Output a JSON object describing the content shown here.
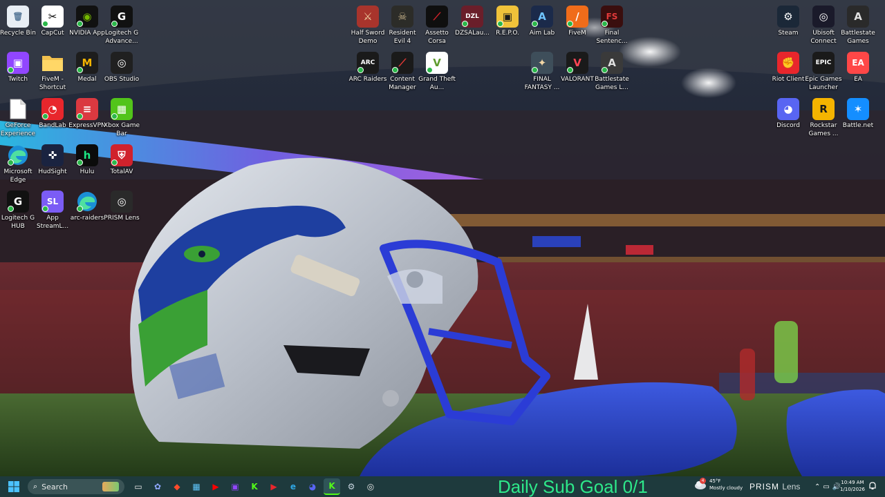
{
  "desktop": {
    "icons": [
      {
        "label": "Recycle Bin",
        "icon": "recycle-bin-icon",
        "bg": "#e8eef5",
        "fg": "#5a7a9a",
        "glyph": "🗑",
        "shortcut": false
      },
      {
        "label": "CapCut",
        "icon": "capcut-icon",
        "bg": "#ffffff",
        "fg": "#000000",
        "glyph": "✂",
        "shortcut": true
      },
      {
        "label": "NVIDIA App",
        "icon": "nvidia-icon",
        "bg": "#111111",
        "fg": "#76b900",
        "glyph": "◉",
        "shortcut": true
      },
      {
        "label": "Logitech G Advance...",
        "icon": "logitech-g-icon",
        "bg": "#111111",
        "fg": "#ffffff",
        "glyph": "G",
        "shortcut": true
      },
      {
        "label": "Twitch",
        "icon": "twitch-icon",
        "bg": "#9146ff",
        "fg": "#ffffff",
        "glyph": "▣",
        "shortcut": true
      },
      {
        "label": "FiveM - Shortcut",
        "icon": "folder-icon",
        "bg": "#f2c14e",
        "fg": "#c08a1a",
        "glyph": "",
        "shortcut": false
      },
      {
        "label": "Medal",
        "icon": "medal-icon",
        "bg": "#1d1d1d",
        "fg": "#f5b400",
        "glyph": "M",
        "shortcut": true
      },
      {
        "label": "OBS Studio",
        "icon": "obs-icon",
        "bg": "#202020",
        "fg": "#ffffff",
        "glyph": "◎",
        "shortcut": false
      },
      {
        "label": "GeForce Experience",
        "icon": "document-icon",
        "bg": "#ffffff",
        "fg": "#888888",
        "glyph": "",
        "shortcut": false
      },
      {
        "label": "BandLab",
        "icon": "bandlab-icon",
        "bg": "#e8262c",
        "fg": "#ffffff",
        "glyph": "◔",
        "shortcut": true
      },
      {
        "label": "ExpressVPN",
        "icon": "expressvpn-icon",
        "bg": "#da3940",
        "fg": "#ffffff",
        "glyph": "≡",
        "shortcut": true
      },
      {
        "label": "Xbox Game Bar",
        "icon": "xbox-game-bar-icon",
        "bg": "#52c41a",
        "fg": "#ffffff",
        "glyph": "▦",
        "shortcut": true
      },
      {
        "label": "Microsoft Edge",
        "icon": "edge-icon",
        "bg": "#1b8fd6",
        "fg": "#4fe0a0",
        "glyph": "e",
        "shortcut": true
      },
      {
        "label": "HudSight",
        "icon": "hudsight-icon",
        "bg": "#1a2340",
        "fg": "#ffffff",
        "glyph": "✜",
        "shortcut": false
      },
      {
        "label": "Hulu",
        "icon": "hulu-icon",
        "bg": "#0b0b0b",
        "fg": "#1ce783",
        "glyph": "h",
        "shortcut": true
      },
      {
        "label": "TotalAV",
        "icon": "totalav-icon",
        "bg": "#d0222c",
        "fg": "#ffffff",
        "glyph": "⛨",
        "shortcut": true
      },
      {
        "label": "Logitech G HUB",
        "icon": "logitech-g-hub-icon",
        "bg": "#111111",
        "fg": "#ffffff",
        "glyph": "G",
        "shortcut": true
      },
      {
        "label": "App StreamL...",
        "icon": "streamlabs-icon",
        "bg": "#7b5cf5",
        "fg": "#ffffff",
        "glyph": "SL",
        "shortcut": true
      },
      {
        "label": "arc-raiders",
        "icon": "edge-icon",
        "bg": "#1b8fd6",
        "fg": "#4fe0a0",
        "glyph": "e",
        "shortcut": true
      },
      {
        "label": "PRISM Lens",
        "icon": "prism-lens-icon",
        "bg": "#2a2a2a",
        "fg": "#ffffff",
        "glyph": "◎",
        "shortcut": false
      },
      {
        "label": "Half Sword Demo",
        "icon": "half-sword-icon",
        "bg": "#a8342c",
        "fg": "#f2d7a6",
        "glyph": "⚔",
        "shortcut": false
      },
      {
        "label": "Resident Evil 4",
        "icon": "resident-evil-4-icon",
        "bg": "#2c2c28",
        "fg": "#c7b38a",
        "glyph": "☠",
        "shortcut": false
      },
      {
        "label": "Assetto Corsa",
        "icon": "assetto-corsa-icon",
        "bg": "#0f0f0f",
        "fg": "#d3222a",
        "glyph": "⟋",
        "shortcut": false
      },
      {
        "label": "DZSALau...",
        "icon": "dzsa-launcher-icon",
        "bg": "#6a1e2a",
        "fg": "#ffffff",
        "glyph": "DZL",
        "shortcut": true
      },
      {
        "label": "R.E.P.O.",
        "icon": "repo-icon",
        "bg": "#f0c23a",
        "fg": "#1a1a1a",
        "glyph": "▣",
        "shortcut": true
      },
      {
        "label": "Aim Lab",
        "icon": "aim-lab-icon",
        "bg": "#1b2a4a",
        "fg": "#6ec3ff",
        "glyph": "A",
        "shortcut": true
      },
      {
        "label": "FiveM",
        "icon": "fivem-icon",
        "bg": "#f06c1a",
        "fg": "#ffffff",
        "glyph": "/",
        "shortcut": true
      },
      {
        "label": "Final Sentenc...",
        "icon": "final-sentence-icon",
        "bg": "#3a0e0e",
        "fg": "#e23a3a",
        "glyph": "FS",
        "shortcut": true
      },
      {
        "label": "ARC Raiders",
        "icon": "arc-raiders-icon",
        "bg": "#1a1a1a",
        "fg": "#ffffff",
        "glyph": "ARC",
        "shortcut": true
      },
      {
        "label": "Content Manager",
        "icon": "content-manager-icon",
        "bg": "#1a1a1a",
        "fg": "#e53935",
        "glyph": "⟋",
        "shortcut": true
      },
      {
        "label": "Grand Theft Au...",
        "icon": "gta-v-icon",
        "bg": "#ffffff",
        "fg": "#5f9b2e",
        "glyph": "V",
        "shortcut": true
      },
      {
        "label": "FINAL FANTASY ...",
        "icon": "final-fantasy-icon",
        "bg": "#3e4e5a",
        "fg": "#f2d7a6",
        "glyph": "✦",
        "shortcut": true
      },
      {
        "label": "VALORANT",
        "icon": "valorant-icon",
        "bg": "#1a1a1a",
        "fg": "#ff4655",
        "glyph": "V",
        "shortcut": true
      },
      {
        "label": "Battlestate Games L...",
        "icon": "battlestate-launcher-icon",
        "bg": "#3a3a3a",
        "fg": "#e0e0e0",
        "glyph": "A",
        "shortcut": true
      },
      {
        "label": "Steam",
        "icon": "steam-icon",
        "bg": "#1b2838",
        "fg": "#ffffff",
        "glyph": "⚙",
        "shortcut": false
      },
      {
        "label": "Ubisoft Connect",
        "icon": "ubisoft-connect-icon",
        "bg": "#1a1a2a",
        "fg": "#ffffff",
        "glyph": "◎",
        "shortcut": false
      },
      {
        "label": "Battlestate Games",
        "icon": "battlestate-games-icon",
        "bg": "#2a2a2a",
        "fg": "#e0e0e0",
        "glyph": "A",
        "shortcut": false
      },
      {
        "label": "Riot Client",
        "icon": "riot-client-icon",
        "bg": "#e8262c",
        "fg": "#ffffff",
        "glyph": "✊",
        "shortcut": false
      },
      {
        "label": "Epic Games Launcher",
        "icon": "epic-games-icon",
        "bg": "#1a1a1a",
        "fg": "#ffffff",
        "glyph": "EPIC",
        "shortcut": false
      },
      {
        "label": "EA",
        "icon": "ea-icon",
        "bg": "#ff4747",
        "fg": "#ffffff",
        "glyph": "EA",
        "shortcut": false
      },
      {
        "label": "Discord",
        "icon": "discord-icon",
        "bg": "#5865f2",
        "fg": "#ffffff",
        "glyph": "◕",
        "shortcut": false
      },
      {
        "label": "Rockstar Games ...",
        "icon": "rockstar-games-icon",
        "bg": "#f5b400",
        "fg": "#1a1a1a",
        "glyph": "R",
        "shortcut": false
      },
      {
        "label": "Battle.net",
        "icon": "battle-net-icon",
        "bg": "#148eff",
        "fg": "#ffffff",
        "glyph": "✶",
        "shortcut": false
      }
    ]
  },
  "taskbar": {
    "search_placeholder": "Search",
    "apps": [
      {
        "icon": "file-explorer-icon",
        "glyph": "▭",
        "color": "#e8e8e8"
      },
      {
        "icon": "copilot-icon",
        "glyph": "✿",
        "color": "#8fa8ff"
      },
      {
        "icon": "app-red-icon",
        "glyph": "◆",
        "color": "#ff4b2b"
      },
      {
        "icon": "microsoft-store-icon",
        "glyph": "▦",
        "color": "#5ec3f7"
      },
      {
        "icon": "youtube-icon",
        "glyph": "▶",
        "color": "#ff0000"
      },
      {
        "icon": "twitch-icon",
        "glyph": "▣",
        "color": "#9146ff"
      },
      {
        "icon": "kick-icon",
        "glyph": "K",
        "color": "#53fc18"
      },
      {
        "icon": "app-play-icon",
        "glyph": "▶",
        "color": "#e8262c"
      },
      {
        "icon": "edge-icon",
        "glyph": "e",
        "color": "#2fa6e3"
      },
      {
        "icon": "discord-icon",
        "glyph": "◕",
        "color": "#5865f2"
      },
      {
        "icon": "kick-active-icon",
        "glyph": "K",
        "color": "#53fc18"
      },
      {
        "icon": "steam-icon",
        "glyph": "⚙",
        "color": "#c7d5e0"
      },
      {
        "icon": "obs-icon",
        "glyph": "◎",
        "color": "#e8e8e8"
      }
    ],
    "overlay_text": "Daily Sub Goal 0/1",
    "weather": {
      "temp": "45°F",
      "condition": "Mostly cloudy",
      "badge": "4"
    },
    "prism_bold": "PRISM",
    "prism_thin": "Lens",
    "clock": {
      "time": "10:49 AM",
      "date": "1/10/2026"
    }
  },
  "colors": {
    "taskbar_bg": "#1e3a3d",
    "overlay_green": "#2ee88a"
  }
}
